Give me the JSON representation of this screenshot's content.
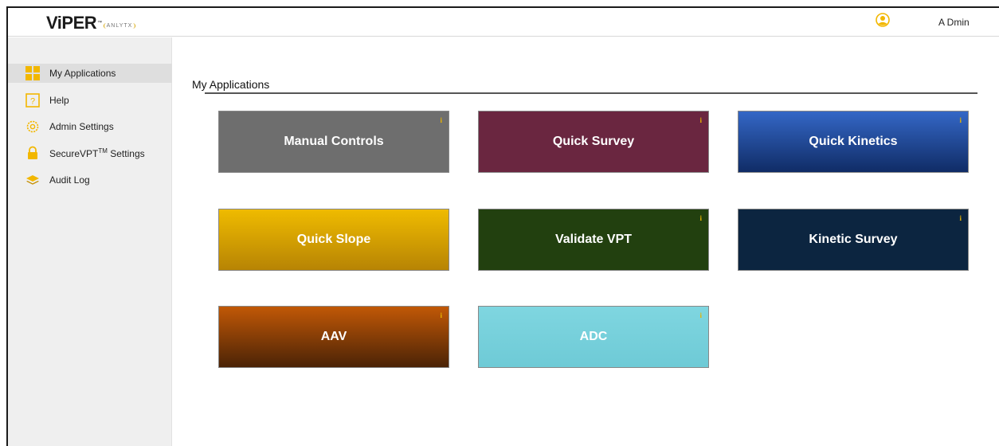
{
  "header": {
    "logo_text": "ViPER",
    "logo_tm": "™",
    "logo_sub": "ANLYTX",
    "user_name": "A Dmin"
  },
  "sidebar": {
    "items": [
      {
        "label": "My Applications",
        "icon": "grid-icon"
      },
      {
        "label": "Help",
        "icon": "question-icon"
      },
      {
        "label": "Admin Settings",
        "icon": "gear-icon"
      },
      {
        "label_prefix": "SecureVPT",
        "label_sup": "TM",
        "label_suffix": " Settings",
        "icon": "lock-icon"
      },
      {
        "label": "Audit Log",
        "icon": "layers-icon"
      }
    ]
  },
  "main": {
    "title": "My Applications",
    "info_glyph": "i",
    "tiles": [
      {
        "label": "Manual Controls",
        "color": "#6e6e6e"
      },
      {
        "label": "Quick Survey",
        "color": "#6a2640"
      },
      {
        "label": "Quick Kinetics",
        "color": "#1d4fa0"
      },
      {
        "label": "Quick Slope",
        "color": "#e2b200"
      },
      {
        "label": "Validate VPT",
        "color": "#22400f"
      },
      {
        "label": "Kinetic Survey",
        "color": "#0c2540"
      },
      {
        "label": "AAV",
        "color": "#b94e06"
      },
      {
        "label": "ADC",
        "color": "#7fd6e0"
      }
    ]
  },
  "colors": {
    "accent_yellow": "#f2b700",
    "active_nav_bg": "#dedede"
  }
}
